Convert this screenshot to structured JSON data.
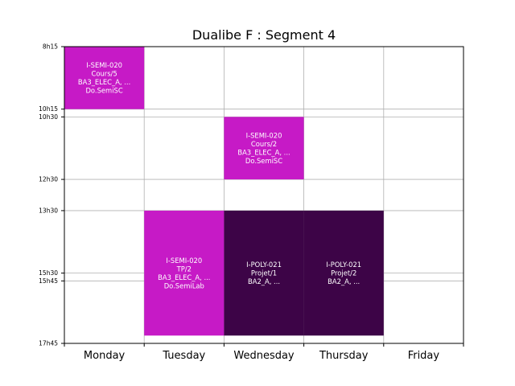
{
  "chart_data": {
    "type": "timetable",
    "title": "Dualibe F : Segment 4",
    "days": [
      "Monday",
      "Tuesday",
      "Wednesday",
      "Thursday",
      "Friday"
    ],
    "time_ticks": [
      {
        "label": "8h15",
        "hour": 8.25
      },
      {
        "label": "10h15",
        "hour": 10.25
      },
      {
        "label": "10h30",
        "hour": 10.5
      },
      {
        "label": "12h30",
        "hour": 12.5
      },
      {
        "label": "13h30",
        "hour": 13.5
      },
      {
        "label": "15h30",
        "hour": 15.5
      },
      {
        "label": "15h45",
        "hour": 15.75
      },
      {
        "label": "17h45",
        "hour": 17.75
      }
    ],
    "ylim": [
      8.25,
      17.75
    ],
    "grid": true,
    "events": [
      {
        "day": 0,
        "day_span": 1,
        "start": 8.25,
        "end": 10.25,
        "lines": [
          "I-SEMI-020",
          "Cours/5",
          "BA3_ELEC_A, ...",
          "Do.SemiSC"
        ],
        "color": "#c61ac6"
      },
      {
        "day": 2,
        "day_span": 1,
        "start": 10.5,
        "end": 12.5,
        "lines": [
          "I-SEMI-020",
          "Cours/2",
          "BA3_ELEC_A, ...",
          "Do.SemiSC"
        ],
        "color": "#c61ac6"
      },
      {
        "day": 1,
        "day_span": 1,
        "start": 13.5,
        "end": 17.5,
        "lines": [
          "I-SEMI-020",
          "TP/2",
          "BA3_ELEC_A, ...",
          "Do.SemiLab"
        ],
        "color": "#c61ac6"
      },
      {
        "day": 2,
        "day_span": 1,
        "start": 13.5,
        "end": 17.5,
        "lines": [
          "I-POLY-021",
          "Projet/1",
          "BA2_A, ..."
        ],
        "color": "#3d0447"
      },
      {
        "day": 3,
        "day_span": 1,
        "start": 13.5,
        "end": 17.5,
        "lines": [
          "I-POLY-021",
          "Projet/2",
          "BA2_A, ..."
        ],
        "color": "#3d0447"
      }
    ]
  }
}
